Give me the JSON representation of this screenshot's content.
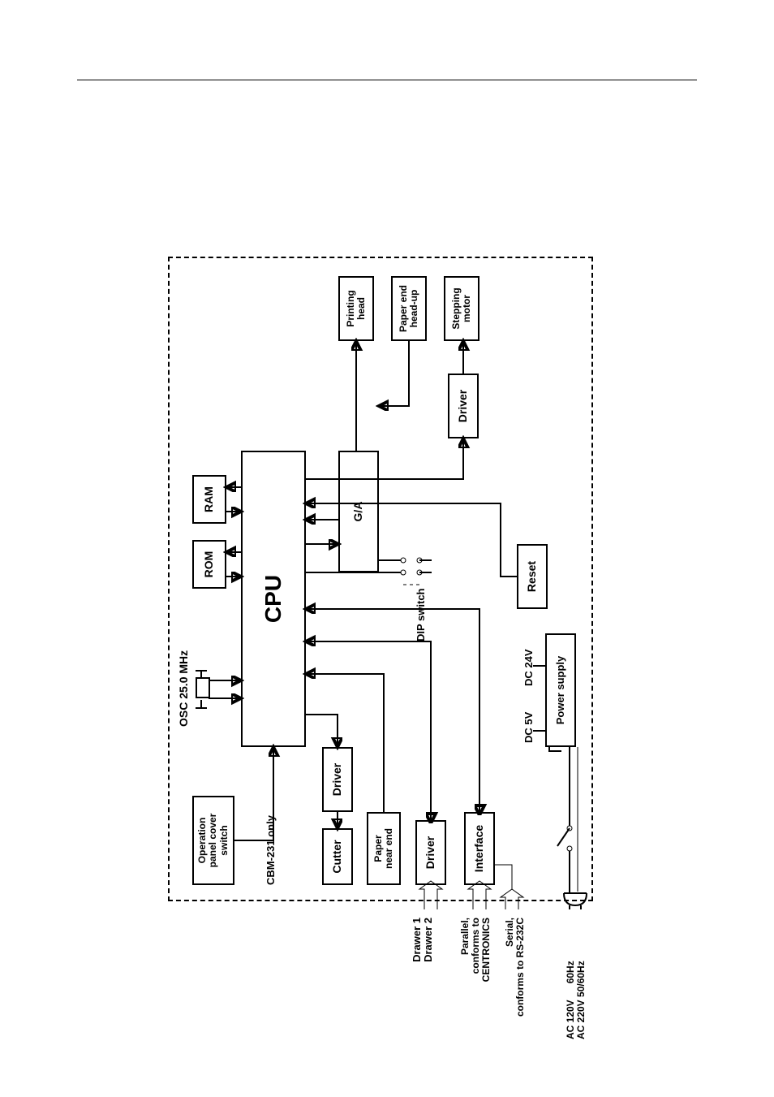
{
  "labels": {
    "osc": "OSC 25.0 MHz",
    "op_panel": "Operation\npanel cover\nswitch",
    "rom": "ROM",
    "ram": "RAM",
    "cpu": "CPU",
    "cbm": "CBM-231 only",
    "driver": "Driver",
    "cutter": "Cutter",
    "paper_near_end": "Paper\nnear end",
    "interface": "Interface",
    "ga": "G/A",
    "dip": "DIP switch",
    "printing_head": "Printing\nhead",
    "paper_end": "Paper end\nhead-up",
    "stepping_motor": "Stepping\nmotor",
    "reset": "Reset",
    "dc5": "DC 5V",
    "dc24": "DC 24V",
    "power_supply": "Power supply",
    "drawer": "Drawer 1\nDrawer 2",
    "parallel": "Parallel,\nconforms to\nCENTRONICS",
    "serial": "Serial,\nconforms to RS-232C",
    "ac": "AC 120V      60Hz\nAC 220V 50/60Hz"
  }
}
